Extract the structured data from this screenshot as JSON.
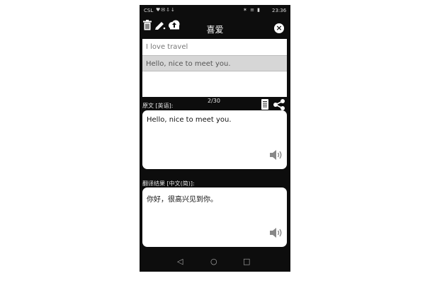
{
  "status_bar": {
    "carrier": "CSL",
    "left_icons": "♥✉⇩↓",
    "right_icons": "✶ ≡ ▮",
    "time": "23:36"
  },
  "toolbar": {
    "title": "喜爱",
    "delete_icon": "trash-icon",
    "edit_icon": "pencil-icon",
    "upload_icon": "cloud-upload-icon",
    "close_icon": "close-icon",
    "close_glyph": "×"
  },
  "history": {
    "items": [
      {
        "text": "I love travel"
      },
      {
        "text": "Hello, nice to meet you."
      }
    ],
    "selected_index": 1
  },
  "source": {
    "label": "原文 [英语]:",
    "counter": "2/30",
    "text": "Hello, nice to meet you."
  },
  "translation": {
    "label": "翻译结果 [中文(简)]:",
    "text": "你好，很高兴见到你。"
  },
  "nav": {
    "back": "◁",
    "home": "○",
    "recents": "□"
  },
  "colors": {
    "background": "#0d0d0d",
    "card": "#ffffff",
    "selected_row": "#d6d6d6"
  }
}
